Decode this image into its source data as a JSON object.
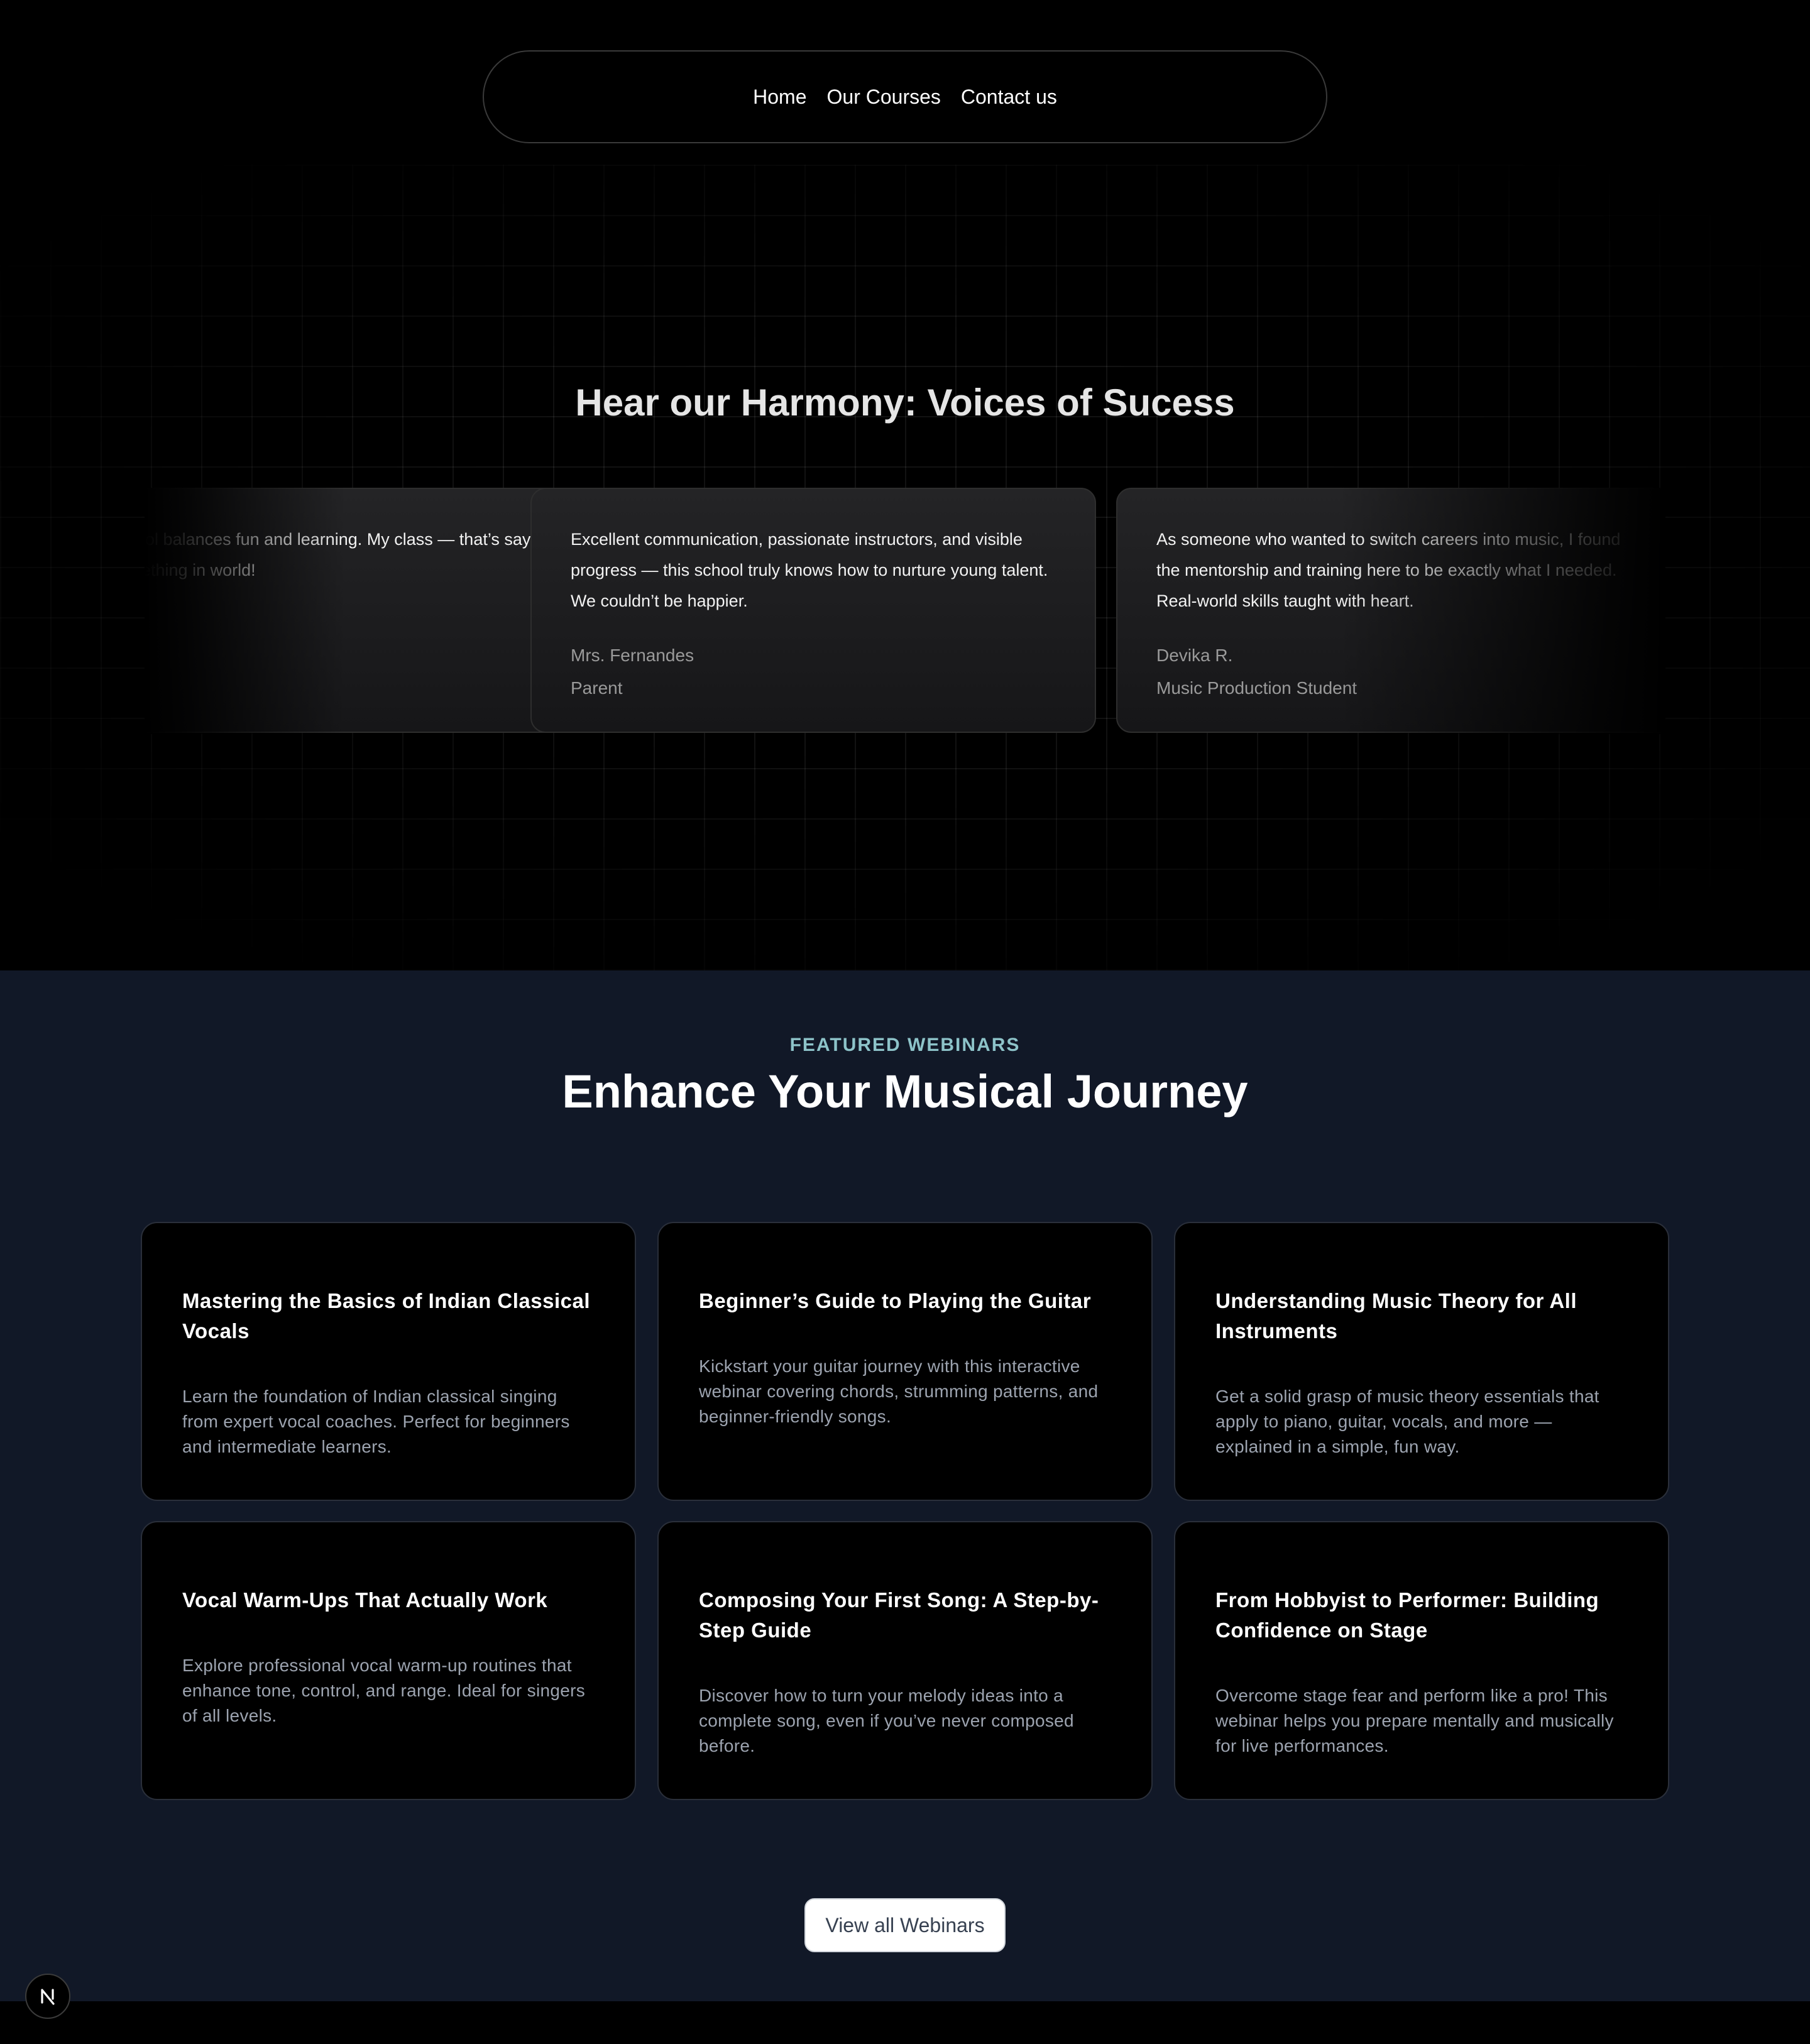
{
  "nav": {
    "links": [
      "Home",
      "Our Courses",
      "Contact us"
    ]
  },
  "testimonials": {
    "title": "Hear our Harmony: Voices of Sucess",
    "items": [
      {
        "quote": "school balances fun and learning. My class — that’s saying something in world!",
        "name": "",
        "role": ""
      },
      {
        "quote": "Excellent communication, passionate instructors, and visible progress — this school truly knows how to nurture young talent. We couldn’t be happier.",
        "name": "Mrs. Fernandes",
        "role": "Parent"
      },
      {
        "quote": "As someone who wanted to switch careers into music, I found the mentorship and training here to be exactly what I needed. Real-world skills taught with heart.",
        "name": "Devika R.",
        "role": "Music Production Student"
      }
    ]
  },
  "webinars": {
    "eyebrow": "FEATURED WEBINARS",
    "title": "Enhance Your Musical Journey",
    "cards": [
      {
        "title": "Mastering the Basics of Indian Classical Vocals",
        "description": "Learn the foundation of Indian classical singing from expert vocal coaches. Perfect for beginners and intermediate learners."
      },
      {
        "title": "Beginner’s Guide to Playing the Guitar",
        "description": "Kickstart your guitar journey with this interactive webinar covering chords, strumming patterns, and beginner-friendly songs."
      },
      {
        "title": "Understanding Music Theory for All Instruments",
        "description": "Get a solid grasp of music theory essentials that apply to piano, guitar, vocals, and more — explained in a simple, fun way."
      },
      {
        "title": "Vocal Warm-Ups That Actually Work",
        "description": "Explore professional vocal warm-up routines that enhance tone, control, and range. Ideal for singers of all levels."
      },
      {
        "title": "Composing Your First Song: A Step-by-Step Guide",
        "description": "Discover how to turn your melody ideas into a complete song, even if you’ve never composed before."
      },
      {
        "title": "From Hobbyist to Performer: Building Confidence on Stage",
        "description": "Overcome stage fear and perform like a pro! This webinar helps you prepare mentally and musically for live performances."
      }
    ],
    "view_all_label": "View all Webinars"
  },
  "badge": {
    "letter": "N",
    "icon": "nextjs-logo-icon"
  },
  "colors": {
    "page_bg": "#000000",
    "webinar_bg": "#111827",
    "eyebrow": "#8dc3c9",
    "muted_text": "#9ca3af"
  }
}
